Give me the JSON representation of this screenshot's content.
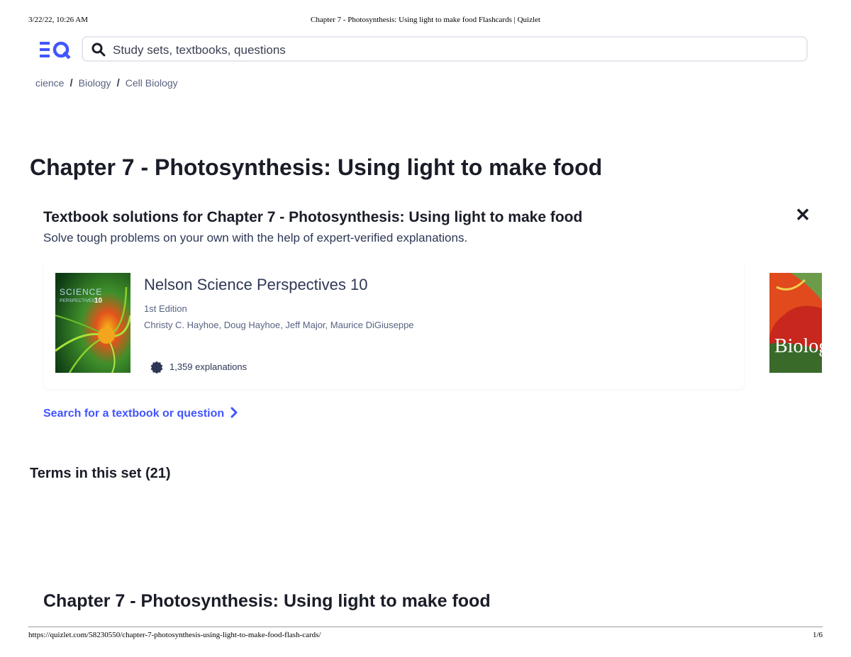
{
  "print_header": {
    "date": "3/22/22, 10:26 AM",
    "title": "Chapter 7 - Photosynthesis: Using light to make food Flashcards | Quizlet"
  },
  "search": {
    "placeholder": "Study sets, textbooks, questions"
  },
  "breadcrumbs": [
    "cience",
    "Biology",
    "Cell Biology"
  ],
  "page_title": "Chapter 7 - Photosynthesis: Using light to make food",
  "textbook_section": {
    "title": "Textbook solutions for Chapter 7 - Photosynthesis: Using light to make food",
    "subtitle": "Solve tough problems on your own with the help of expert-verified explanations.",
    "book": {
      "name": "Nelson Science Perspectives 10",
      "edition": "1st Edition",
      "authors": "Christy C. Hayhoe, Doug Hayhoe, Jeff Major, Maurice DiGiuseppe",
      "explanations": "1,359 explanations",
      "cover_text_1": "SCIENCE",
      "cover_text_2": "PERSPECTIVES",
      "cover_text_3": "10"
    },
    "book2": {
      "cover_text": "Biolog"
    },
    "search_link": "Search for a textbook or question"
  },
  "terms_heading": "Terms in this set (21)",
  "bottom_title": "Chapter 7 - Photosynthesis: Using light to make food",
  "print_footer": {
    "url": "https://quizlet.com/58230550/chapter-7-photosynthesis-using-light-to-make-food-flash-cards/",
    "page": "1/6"
  },
  "colors": {
    "brand": "#4255ff",
    "text": "#1a1d28",
    "muted": "#586380"
  }
}
